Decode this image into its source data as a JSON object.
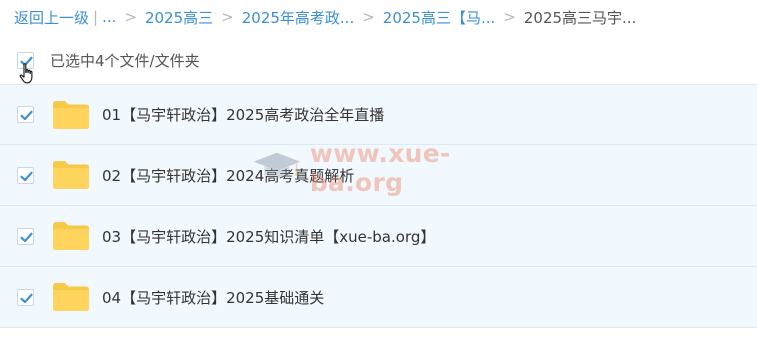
{
  "breadcrumb": {
    "back": "返回上一级",
    "ellipsis": "...",
    "items": [
      "2025高三",
      "2025年高考政...",
      "2025高三【马..."
    ],
    "current": "2025高三马宇..."
  },
  "selection": {
    "text": "已选中4个文件/文件夹",
    "checked": true
  },
  "files": [
    {
      "name": "01【马宇轩政治】2025高考政治全年直播",
      "checked": true
    },
    {
      "name": "02【马宇轩政治】2024高考真题解析",
      "checked": true
    },
    {
      "name": "03【马宇轩政治】2025知识清单【xue-ba.org】",
      "checked": true
    },
    {
      "name": "04【马宇轩政治】2025基础通关",
      "checked": true
    }
  ],
  "watermark": {
    "text": "www.xue-ba.org"
  },
  "colors": {
    "link": "#3b8fd9",
    "row_bg": "#f1f8fe",
    "check": "#3b8fd9",
    "folder": "#ffd45c"
  }
}
